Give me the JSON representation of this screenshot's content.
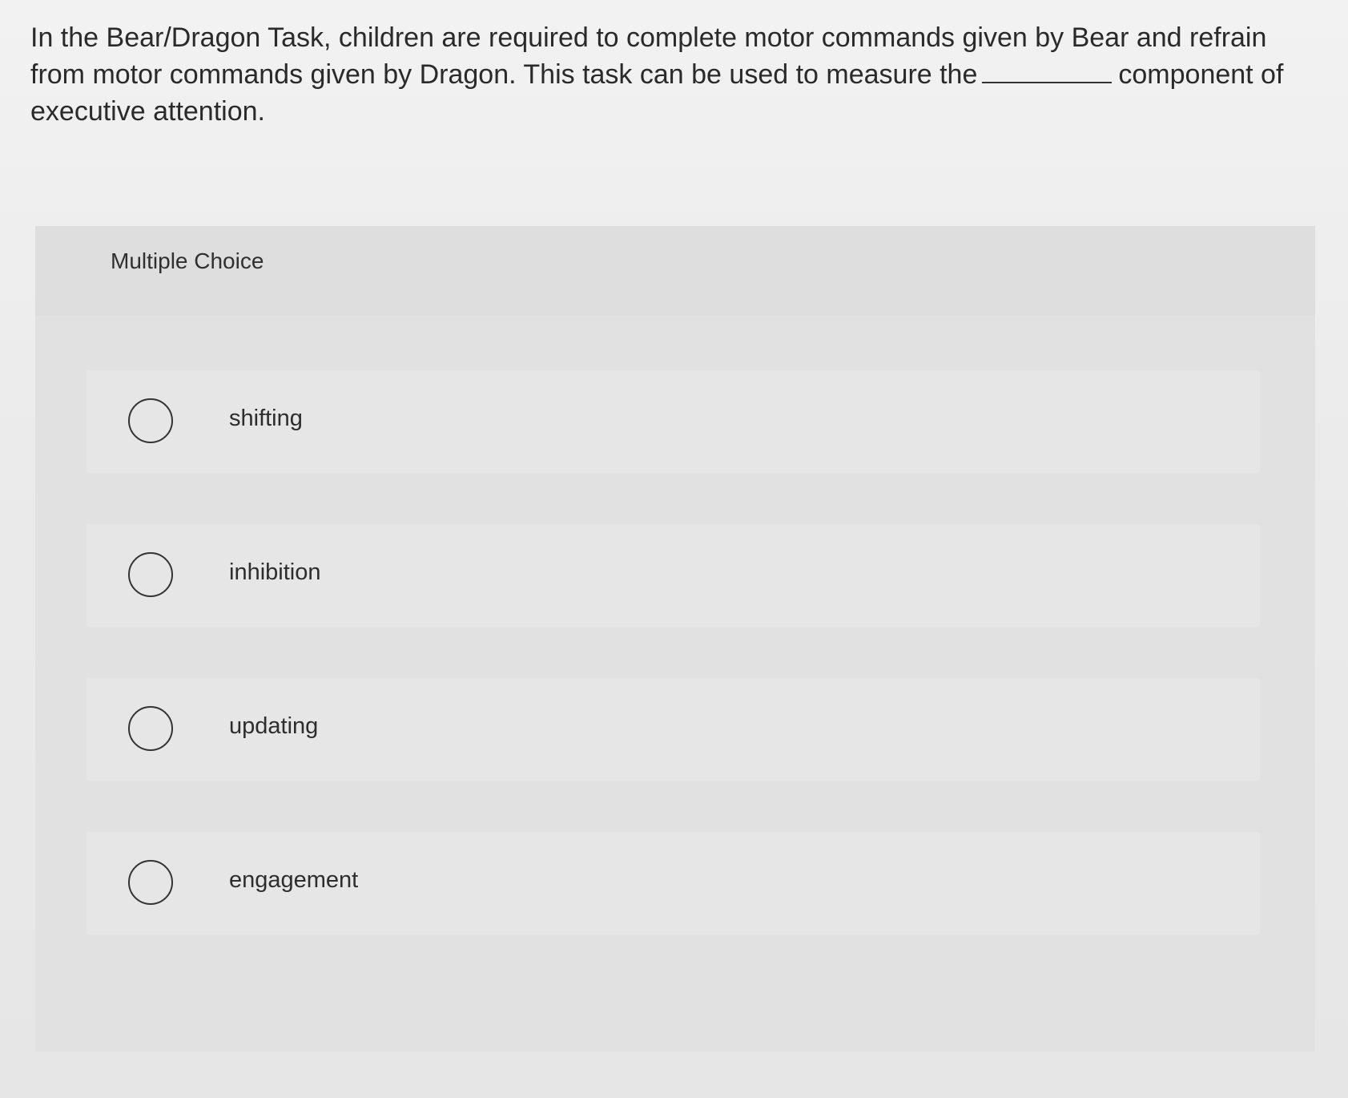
{
  "question": {
    "part1": "In the Bear/Dragon Task, children are required to complete motor commands given by Bear and refrain from motor commands given by Dragon.  This task can be used to measure the",
    "part2": "component of executive attention."
  },
  "panel": {
    "title": "Multiple Choice"
  },
  "options": [
    {
      "label": "shifting",
      "selected": false
    },
    {
      "label": "inhibition",
      "selected": false
    },
    {
      "label": "updating",
      "selected": false
    },
    {
      "label": "engagement",
      "selected": false
    }
  ]
}
